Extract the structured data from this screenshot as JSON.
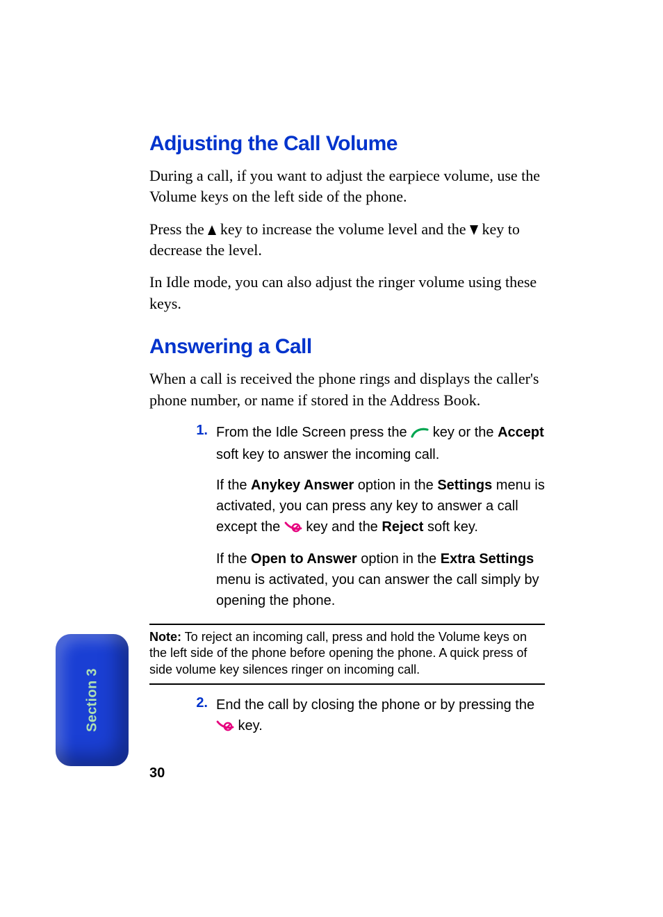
{
  "section_tab": "Section 3",
  "page_number": "30",
  "heading1": "Adjusting the Call Volume",
  "h1_p1": "During a call, if you want to adjust the earpiece volume, use the Volume keys on the left side of the phone.",
  "h1_p2a": "Press the ",
  "h1_p2b": " key to increase the volume level and the ",
  "h1_p2c": " key to decrease the level.",
  "h1_p3": "In Idle mode, you can also adjust the ringer volume using these keys.",
  "heading2": "Answering a Call",
  "h2_p1": "When a call is received the phone rings and displays the caller's phone number, or name if stored in the Address Book.",
  "step1_num": "1.",
  "step1a": "From the Idle Screen press the ",
  "step1b": " key or the ",
  "step1_accept": "Accept",
  "step1c": " soft key to answer the incoming call.",
  "step1_sub1a": "If the ",
  "step1_anykey": "Anykey Answer",
  "step1_sub1b": " option in the ",
  "step1_settings": "Settings",
  "step1_sub1c": " menu is activated, you can press any key to answer a call except the ",
  "step1_sub1d": " key and the ",
  "step1_reject": "Reject",
  "step1_sub1e": " soft key.",
  "step1_sub2a": "If the ",
  "step1_open": "Open to Answer",
  "step1_sub2b": " option in the ",
  "step1_extra": "Extra Settings",
  "step1_sub2c": " menu is activated, you can answer the call simply by opening the phone.",
  "note_label": "Note:",
  "note_text": " To reject an incoming call, press and hold the Volume keys on the left side of the phone before opening the phone. A quick press of side volume key silences ringer on incoming call.",
  "step2_num": "2.",
  "step2a": "End the call by closing the phone or by pressing the ",
  "step2b": " key."
}
